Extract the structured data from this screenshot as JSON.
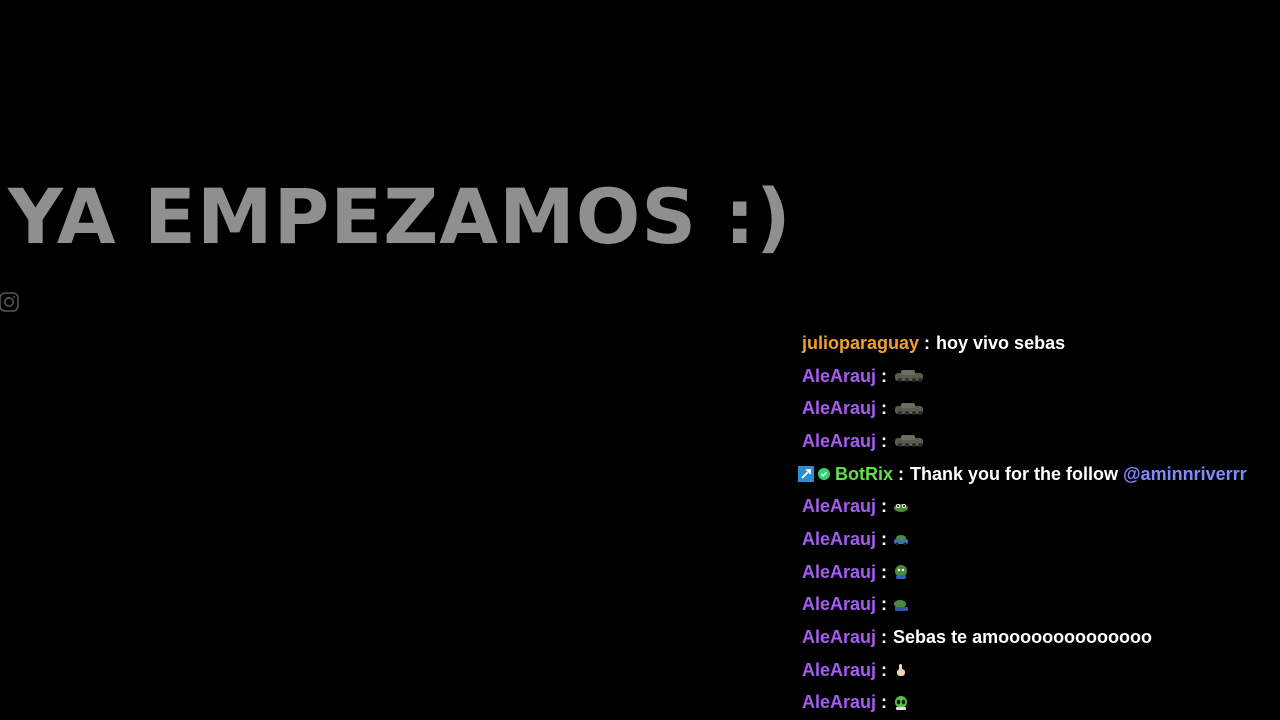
{
  "overlay": {
    "headline": "YA EMPEZAMOS :)",
    "headline_color": "#8f8f8f",
    "background": "#000000"
  },
  "chat": {
    "messages": [
      {
        "user": "julioparaguay",
        "color": "#f0a030",
        "text": "hoy vivo sebas",
        "emote": ""
      },
      {
        "user": "AleArauj",
        "color": "#a65cf2",
        "text": "",
        "emote": "tank-emote"
      },
      {
        "user": "AleArauj",
        "color": "#a65cf2",
        "text": "",
        "emote": "tank-emote"
      },
      {
        "user": "AleArauj",
        "color": "#a65cf2",
        "text": "",
        "emote": "tank-emote"
      },
      {
        "user": "BotRix",
        "color": "#62e04a",
        "text": "Thank you for the follow",
        "mention": "@aminnriverrr",
        "badges": [
          "pickaxe-badge",
          "verified-badge"
        ]
      },
      {
        "user": "AleArauj",
        "color": "#a65cf2",
        "text": "",
        "emote": "frog-emote"
      },
      {
        "user": "AleArauj",
        "color": "#a65cf2",
        "text": "",
        "emote": "frog-car-emote"
      },
      {
        "user": "AleArauj",
        "color": "#a65cf2",
        "text": "",
        "emote": "frog-wave-emote"
      },
      {
        "user": "AleArauj",
        "color": "#a65cf2",
        "text": "",
        "emote": "frog-lying-emote"
      },
      {
        "user": "AleArauj",
        "color": "#a65cf2",
        "text": "Sebas te amoooooooooooooo",
        "emote": ""
      },
      {
        "user": "AleArauj",
        "color": "#a65cf2",
        "text": "",
        "emote": "hand-emote"
      },
      {
        "user": "AleArauj",
        "color": "#a65cf2",
        "text": "",
        "emote": "alien-emote"
      }
    ]
  }
}
